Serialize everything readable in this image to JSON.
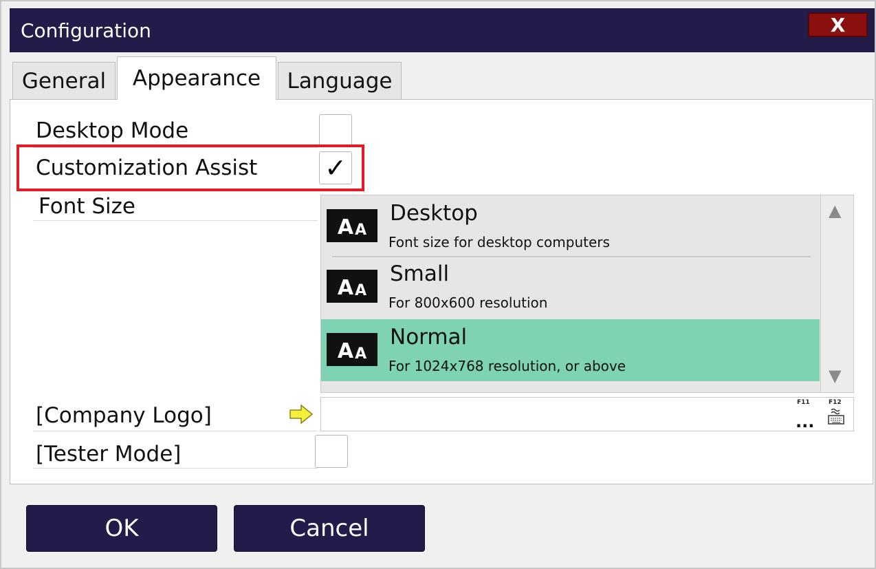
{
  "window": {
    "title": "Configuration",
    "close_label": "X"
  },
  "tabs": [
    {
      "label": "General",
      "active": false
    },
    {
      "label": "Appearance",
      "active": true
    },
    {
      "label": "Language",
      "active": false
    }
  ],
  "settings": {
    "desktop_mode": {
      "label": "Desktop Mode",
      "checked": false
    },
    "customization_assist": {
      "label": "Customization Assist",
      "checked": true,
      "check_glyph": "✓"
    },
    "font_size": {
      "label": "Font Size",
      "options": [
        {
          "icon_big": "A",
          "icon_small": "A",
          "title": "Desktop",
          "description": "Font size for desktop computers",
          "selected": false
        },
        {
          "icon_big": "A",
          "icon_small": "A",
          "title": "Small",
          "description": "For 800x600 resolution",
          "selected": false
        },
        {
          "icon_big": "A",
          "icon_small": "A",
          "title": "Normal",
          "description": "For 1024x768 resolution, or above",
          "selected": true
        }
      ]
    },
    "company_logo": {
      "label": "[Company Logo]",
      "value": "",
      "f11_label": "F11",
      "f12_label": "F12",
      "browse_glyph": "..."
    },
    "tester_mode": {
      "label": "[Tester Mode]",
      "checked": false
    }
  },
  "buttons": {
    "ok_label": "OK",
    "cancel_label": "Cancel"
  },
  "colors": {
    "titlebar": "#231c4a",
    "close_button": "#8a0f0f",
    "selected_item": "#7dd3b2",
    "highlight_border": "#e11c2a",
    "button_bg": "#231c4a"
  },
  "icons": {
    "scroll_up": "▲",
    "scroll_down": "▼"
  }
}
